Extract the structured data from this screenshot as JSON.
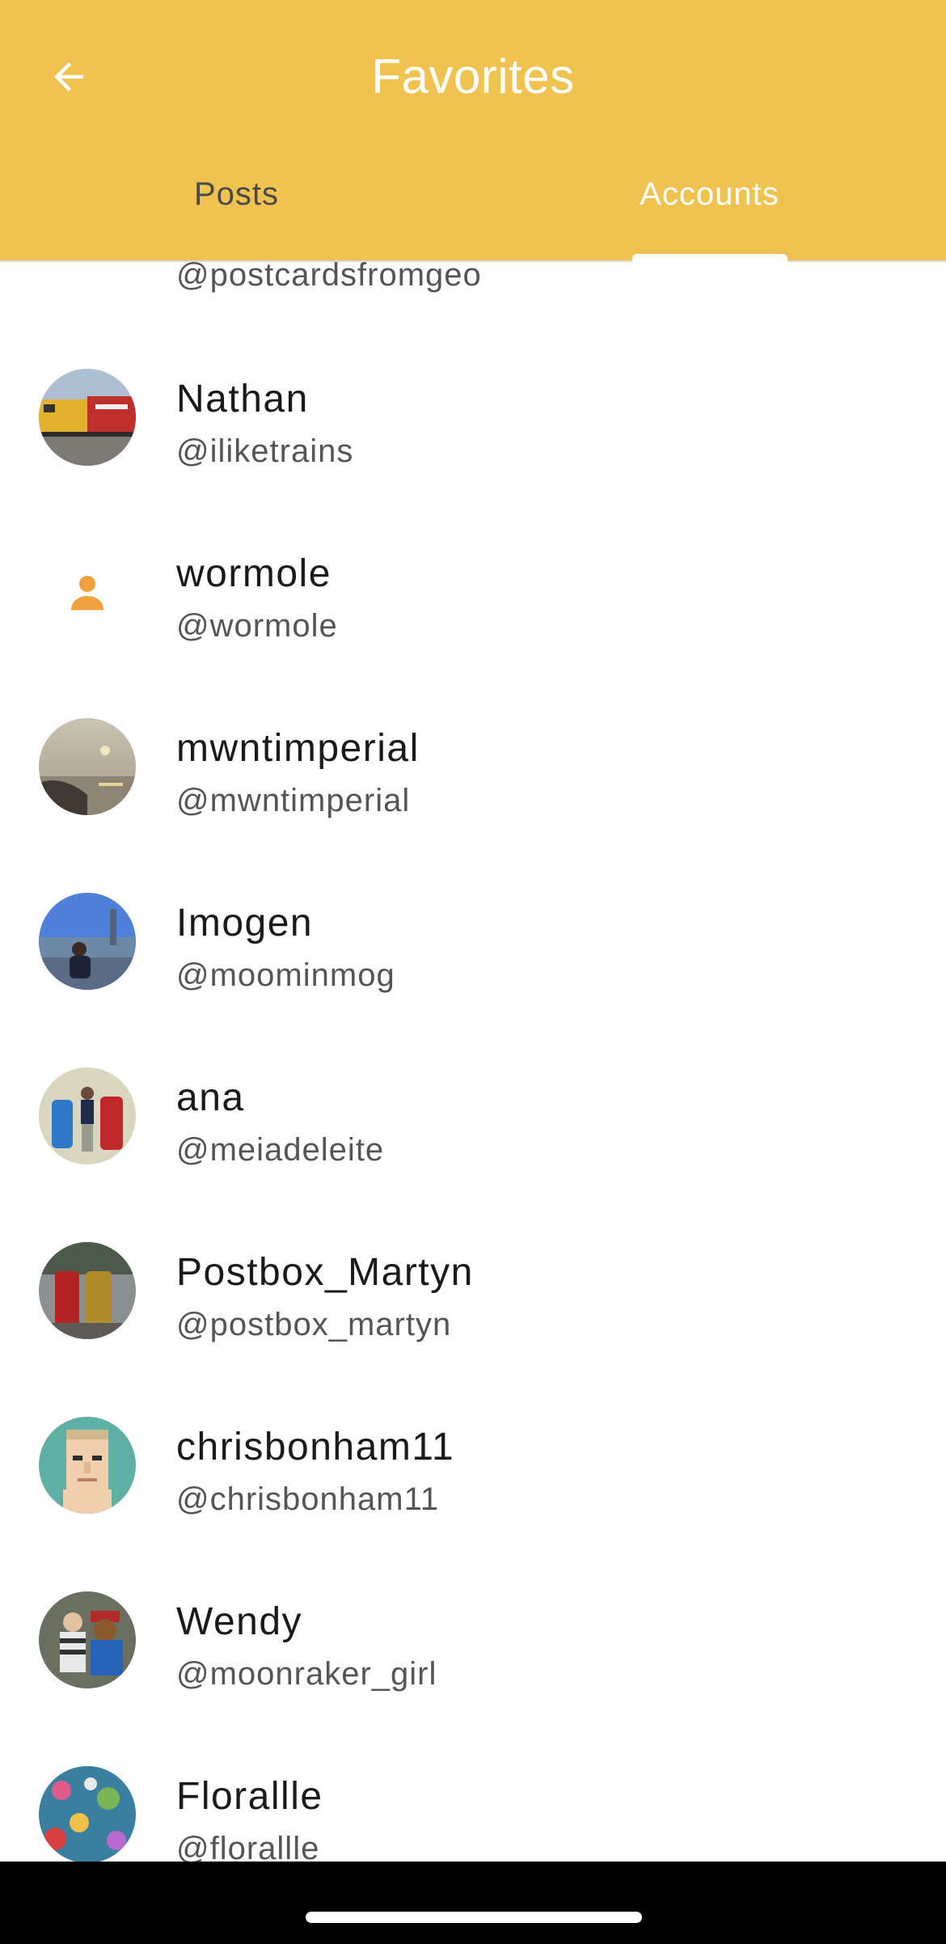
{
  "header": {
    "title": "Favorites",
    "back_icon": "arrow-left-icon",
    "background": "#F0C24F"
  },
  "tabs": [
    {
      "label": "Posts",
      "active": false
    },
    {
      "label": "Accounts",
      "active": true
    }
  ],
  "accounts": [
    {
      "name": "",
      "handle": "@postcardsfromgeo",
      "avatar": "placeholder-person-icon"
    },
    {
      "name": "Nathan",
      "handle": "@iliketrains",
      "avatar": "train-photo"
    },
    {
      "name": "wormole",
      "handle": "@wormole",
      "avatar": "placeholder-person-icon"
    },
    {
      "name": "mwntimperial",
      "handle": "@mwntimperial",
      "avatar": "sunset-coast-photo"
    },
    {
      "name": "Imogen",
      "handle": "@moominmog",
      "avatar": "city-bridge-photo"
    },
    {
      "name": "ana",
      "handle": "@meiadeleite",
      "avatar": "postboxes-photo"
    },
    {
      "name": "Postbox_Martyn",
      "handle": "@postbox_martyn",
      "avatar": "red-gold-postboxes-photo"
    },
    {
      "name": "chrisbonham11",
      "handle": "@chrisbonham11",
      "avatar": "pixel-face-avatar"
    },
    {
      "name": "Wendy",
      "handle": "@moonraker_girl",
      "avatar": "paddington-photo"
    },
    {
      "name": "Florallle",
      "handle": "@florallle",
      "avatar": "knitted-flowers-photo"
    }
  ],
  "colors": {
    "accent": "#F0C24F",
    "placeholder_icon": "#F0A03C",
    "text_primary": "#1a1a1a",
    "text_secondary": "#555555"
  }
}
